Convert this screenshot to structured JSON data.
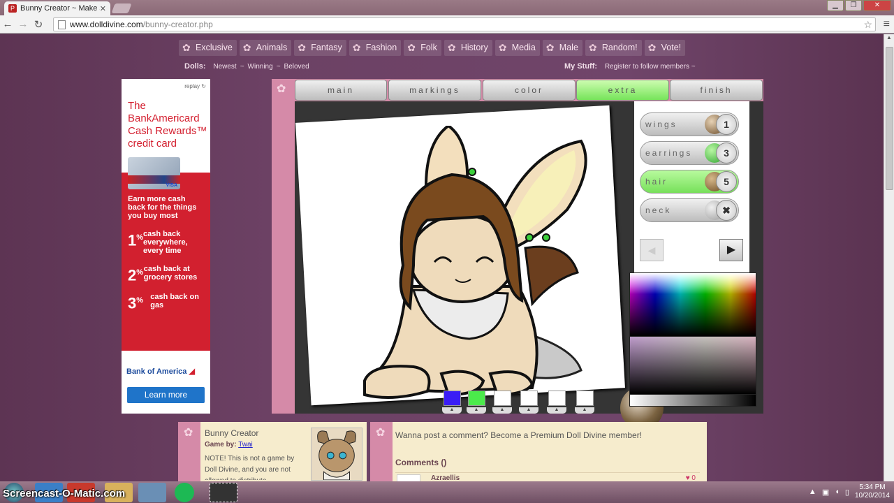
{
  "browser": {
    "tab_title": "Bunny Creator ~ Make a c",
    "url_domain": "www.dolldivine.com",
    "url_path": "/bunny-creator.php"
  },
  "site": {
    "nav": [
      "Exclusive",
      "Animals",
      "Fantasy",
      "Fashion",
      "Folk",
      "History",
      "Media",
      "Male",
      "Random!",
      "Vote!"
    ],
    "dolls_label": "Dolls:",
    "dolls_links": [
      "Newest",
      "Winning",
      "Beloved"
    ],
    "mystuff_label": "My Stuff:",
    "mystuff_text": "Register to follow members ~"
  },
  "ad": {
    "replay": "replay",
    "headline": [
      "The",
      "BankAmericard",
      "Cash Rewards™",
      "credit card"
    ],
    "earn": "Earn more cash back for the things you buy most",
    "rows": [
      {
        "pct": "1",
        "desc": "cash back everywhere, every time"
      },
      {
        "pct": "2",
        "desc": "cash back at grocery stores"
      },
      {
        "pct": "3",
        "desc": "cash back on gas"
      }
    ],
    "bank": "Bank of America",
    "learn": "Learn more"
  },
  "game": {
    "tabs": [
      "main",
      "markings",
      "color",
      "extra",
      "finish"
    ],
    "active_tab": "extra",
    "options": [
      {
        "label": "wings",
        "value": "1"
      },
      {
        "label": "earrings",
        "value": "3"
      },
      {
        "label": "hair",
        "value": "5"
      },
      {
        "label": "neck",
        "value": "✖"
      }
    ],
    "swatch_colors": [
      "#3a1df5",
      "#4bea4b",
      "#ffffff",
      "#ffffff",
      "#ffffff",
      "#ffffff"
    ]
  },
  "info": {
    "title": "Bunny Creator",
    "game_by_label": "Game by:",
    "author": "Twai",
    "note": "NOTE! This is not a game by Doll Divine, and you are not allowed to distribute..."
  },
  "comments": {
    "prompt": "Wanna post a comment? Become a Premium Doll Divine member!",
    "heading": "Comments ()",
    "first_name": "Azraellis",
    "first_likes": "♥ 0"
  },
  "taskbar": {
    "watermark": "Screencast-O-Matic.com",
    "time": "5:34 PM",
    "date": "10/20/2014"
  }
}
